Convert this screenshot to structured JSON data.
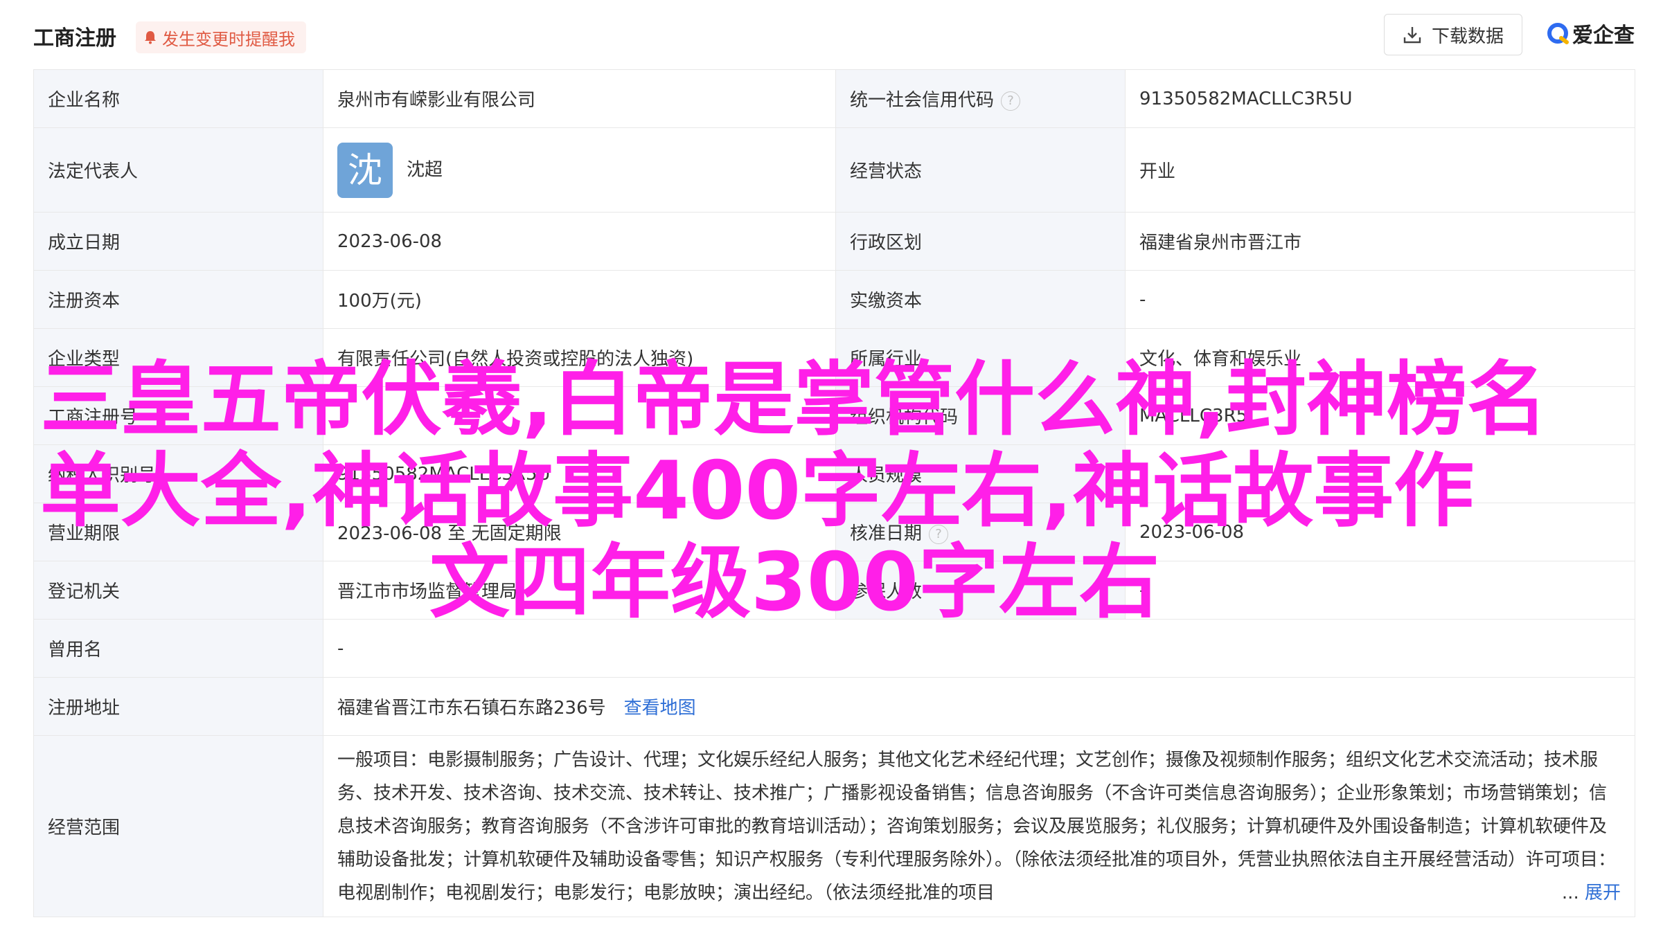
{
  "header": {
    "title": "工商注册",
    "remind_label": "发生变更时提醒我",
    "download_label": "下载数据",
    "logo_text": "爱企查"
  },
  "rows": {
    "company_name_label": "企业名称",
    "company_name": "泉州市有嵘影业有限公司",
    "credit_code_label": "统一社会信用代码",
    "credit_code": "91350582MACLLC3R5U",
    "legal_rep_label": "法定代表人",
    "legal_rep_avatar": "沈",
    "legal_rep": "沈超",
    "status_label": "经营状态",
    "status": "开业",
    "founded_label": "成立日期",
    "founded": "2023-06-08",
    "district_label": "行政区划",
    "district": "福建省泉州市晋江市",
    "capital_label": "注册资本",
    "capital": "100万(元)",
    "paid_label": "实缴资本",
    "paid": "-",
    "type_label": "企业类型",
    "type": "有限责任公司(自然人投资或控股的法人独资)",
    "industry_label": "所属行业",
    "industry": "文化、体育和娱乐业",
    "reg_no_label": "工商注册号",
    "reg_no": "",
    "org_code_label": "组织机构代码",
    "org_code": "MACLLC3R5",
    "tax_label": "纳税人识别号",
    "tax": "91350582MACLLC3R5U",
    "staff_label": "人员规模",
    "staff": "",
    "term_label": "营业期限",
    "term": "2023-06-08 至 无固定期限",
    "approve_label": "核准日期",
    "approve": "2023-06-08",
    "authority_label": "登记机关",
    "authority": "晋江市市场监督管理局",
    "insured_label": "参保人数",
    "insured": "-",
    "former_label": "曾用名",
    "former": "-",
    "address_label": "注册地址",
    "address": "福建省晋江市东石镇石东路236号",
    "map_link": "查看地图",
    "scope_label": "经营范围",
    "scope": "一般项目：电影摄制服务；广告设计、代理；文化娱乐经纪人服务；其他文化艺术经纪代理；文艺创作；摄像及视频制作服务；组织文化艺术交流活动；技术服务、技术开发、技术咨询、技术交流、技术转让、技术推广；广播影视设备销售；信息咨询服务（不含许可类信息咨询服务）；企业形象策划；市场营销策划；信息技术咨询服务；教育咨询服务（不含涉许可审批的教育培训活动）；咨询策划服务；会议及展览服务；礼仪服务；计算机硬件及外围设备制造；计算机软硬件及辅助设备批发；计算机软硬件及辅助设备零售；知识产权服务（专利代理服务除外）。（除依法须经批准的项目外，凭营业执照依法自主开展经营活动）许可项目：电视剧制作；电视剧发行；电影发行；电影放映；演出经纪。（依法须经批准的项目",
    "scope_ellipsis": "...",
    "scope_more": "展开"
  },
  "overlay": {
    "line1": "三皇五帝伏羲,白帝是掌管什么神,封神榜名",
    "line2": "单大全,神话故事400字左右,神话故事作",
    "line3": "文四年级300字左右",
    "color": "#ff1fe8"
  }
}
